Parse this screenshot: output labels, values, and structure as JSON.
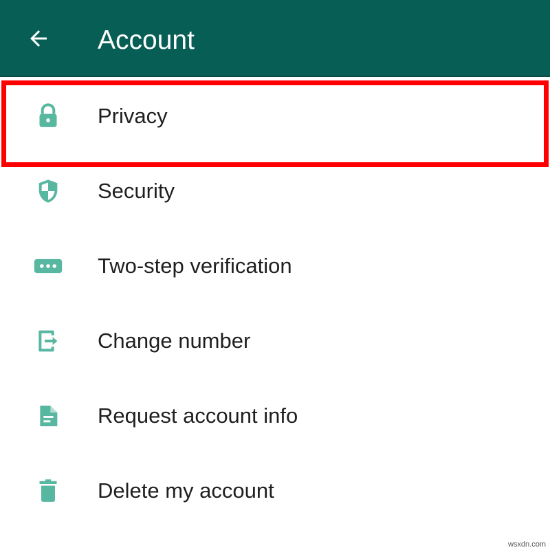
{
  "header": {
    "title": "Account",
    "back_icon": "arrow-left-icon",
    "background": "#075e54"
  },
  "menu": {
    "items": [
      {
        "label": "Privacy",
        "icon": "lock-icon"
      },
      {
        "label": "Security",
        "icon": "shield-icon"
      },
      {
        "label": "Two-step verification",
        "icon": "password-dots-icon"
      },
      {
        "label": "Change number",
        "icon": "change-number-icon"
      },
      {
        "label": "Request account info",
        "icon": "document-icon"
      },
      {
        "label": "Delete my account",
        "icon": "trash-icon"
      }
    ],
    "icon_color": "#57b7a0"
  },
  "highlight": {
    "target": "Privacy",
    "color": "#ff0000"
  },
  "watermark": "wsxdn.com"
}
